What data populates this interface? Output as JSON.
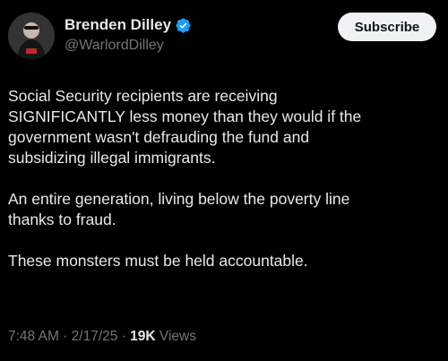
{
  "author": {
    "display_name": "Brenden Dilley",
    "handle": "@WarlordDilley",
    "verified_icon": "verified-badge-icon"
  },
  "actions": {
    "subscribe_label": "Subscribe"
  },
  "tweet": {
    "paragraphs": [
      "Social Security recipients are receiving\nSIGNIFICANTLY less money than they would if the\ngovernment wasn't defrauding the fund and\nsubsidizing illegal immigrants.",
      "An entire generation, living below the poverty line\nthanks to fraud.",
      "These monsters must be held accountable."
    ]
  },
  "meta": {
    "time": "7:48 AM",
    "separator": " · ",
    "date": "2/17/25",
    "views_count": "19K",
    "views_label": " Views"
  },
  "colors": {
    "background": "#000000",
    "primary_text": "#e7e9ea",
    "secondary_text": "#71767b",
    "verified_blue": "#1d9bf0",
    "subscribe_bg": "#eff3f4"
  }
}
